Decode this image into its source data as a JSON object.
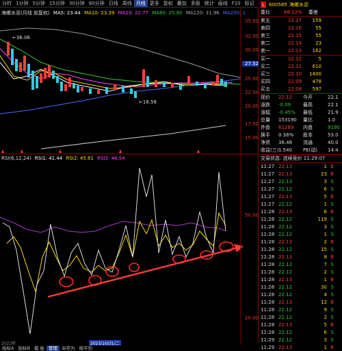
{
  "toolbar": {
    "items": [
      "分时",
      "1分钟",
      "5分钟",
      "15分钟",
      "30分钟",
      "60分钟",
      "日线",
      "周线",
      "月线",
      "更多",
      "复权",
      "叠加",
      "多股",
      "统计",
      "画线",
      "F10",
      "标记",
      "-",
      "-"
    ],
    "active_index": 8
  },
  "main_legend": {
    "name": "海螺水泥(月线 前复权)",
    "ma5": "MA5: 23.44",
    "ma10": "MA10: 23.39",
    "ma20": "MA20: 22.77",
    "ma60": "MA60: 25.80",
    "ma120": "MA120: 31.96",
    "ma250": "MA250: 1",
    "colors": {
      "ma5": "#ffffff",
      "ma10": "#ffdd00",
      "ma20": "#ff44ff",
      "ma60": "#33cc33",
      "ma120": "#999999",
      "ma250": "#4a6cff"
    }
  },
  "main_axis": [
    "35.00",
    "32.50",
    "30.00",
    "27.52",
    "25.00",
    "22.50",
    "20.00",
    "17.50",
    "15.00"
  ],
  "main_annotations": {
    "high": "36.06",
    "low": "18.58"
  },
  "rsi_legend": {
    "name": "RSI(6,12,24)",
    "rsi1": "RSI1: 41.44",
    "rsi2": "RSI2: 45.61",
    "rsi3": "RSI3: 46.54",
    "colors": {
      "rsi1": "#ffffff",
      "rsi2": "#ffdd00",
      "rsi3": "#ff44ff"
    }
  },
  "rsi_axis": [
    "50.00",
    "20.00"
  ],
  "date_bar": {
    "left": "2023年",
    "highlight": "2023/10/31/二"
  },
  "bottom_tabs": [
    "指标A",
    "指标B",
    "模 板",
    "管理",
    "另存为",
    "缩平到"
  ],
  "bottom_active": 3,
  "quote": {
    "code": "600585",
    "name": "海螺水泥",
    "ratio_label": "委比",
    "ratio_value": "68.12%",
    "diff_label": "委差",
    "diff_value": "",
    "asks": [
      {
        "label": "卖五",
        "price": "22.17",
        "vol": "159"
      },
      {
        "label": "卖四",
        "price": "22.16",
        "vol": "55"
      },
      {
        "label": "卖三",
        "price": "22.15",
        "vol": "55"
      },
      {
        "label": "卖二",
        "price": "22.14",
        "vol": "23"
      },
      {
        "label": "卖一",
        "price": "22.13",
        "vol": "162"
      }
    ],
    "bids": [
      {
        "label": "买一",
        "price": "22.12",
        "vol": "5"
      },
      {
        "label": "买二",
        "price": "22.11",
        "vol": "610"
      },
      {
        "label": "买三",
        "price": "22.10",
        "vol": "1400"
      },
      {
        "label": "买四",
        "price": "22.09",
        "vol": "478"
      },
      {
        "label": "买五",
        "price": "22.08",
        "vol": "597"
      }
    ],
    "stats": [
      {
        "l1": "现价",
        "v1": "22.12",
        "l2": "今开",
        "v2": "22.1"
      },
      {
        "l1": "涨跌",
        "v1": "-0.09",
        "l2": "最高",
        "v2": "22.1"
      },
      {
        "l1": "涨幅",
        "v1": "-0.45%",
        "l2": "最低",
        "v2": "21.9"
      },
      {
        "l1": "总量",
        "v1": "153190",
        "l2": "量比",
        "v2": "1.0"
      },
      {
        "l1": "外盘",
        "v1": "61289",
        "l2": "内盘",
        "v2": "9190"
      },
      {
        "l1": "换手",
        "v1": "0.38%",
        "l2": "股本",
        "v2": "53.0"
      },
      {
        "l1": "净资",
        "v1": "36.46",
        "l2": "流通",
        "v2": "40.0"
      },
      {
        "l1": "收益(三)",
        "v1": "1.540",
        "l2": "PE(动)",
        "v2": "14.4"
      }
    ],
    "status": "交易状态: 连续竞价 11:29:07",
    "ticks": [
      {
        "t": "11:27",
        "p": "22.13",
        "v": "1",
        "d": "B"
      },
      {
        "t": "11:27",
        "p": "22.13",
        "v": "23",
        "d": "B"
      },
      {
        "t": "11:27",
        "p": "22.13",
        "v": "3",
        "d": "S"
      },
      {
        "t": "11:27",
        "p": "22.12",
        "v": "6",
        "d": "S"
      },
      {
        "t": "11:27",
        "p": "22.13",
        "v": "5",
        "d": "B"
      },
      {
        "t": "11:27",
        "p": "22.12",
        "v": "1",
        "d": "S"
      },
      {
        "t": "11:28",
        "p": "22.13",
        "v": "6",
        "d": "B"
      },
      {
        "t": "11:28",
        "p": "22.12",
        "v": "119",
        "d": "S"
      },
      {
        "t": "11:28",
        "p": "22.12",
        "v": "3",
        "d": "S"
      },
      {
        "t": "11:28",
        "p": "22.12",
        "v": "1",
        "d": "S"
      },
      {
        "t": "11:28",
        "p": "22.13",
        "v": "2",
        "d": "B"
      },
      {
        "t": "11:28",
        "p": "22.12",
        "v": "15",
        "d": "S"
      },
      {
        "t": "11:28",
        "p": "22.13",
        "v": "8",
        "d": "B"
      },
      {
        "t": "11:28",
        "p": "22.12",
        "v": "7",
        "d": "S"
      },
      {
        "t": "11:28",
        "p": "22.12",
        "v": "2",
        "d": "S"
      },
      {
        "t": "11:28",
        "p": "22.13",
        "v": "1",
        "d": "B"
      },
      {
        "t": "11:28",
        "p": "22.12",
        "v": "30",
        "d": "S"
      },
      {
        "t": "11:28",
        "p": "22.12",
        "v": "4",
        "d": "S"
      },
      {
        "t": "11:28",
        "p": "22.13",
        "v": "12",
        "d": "B"
      },
      {
        "t": "11:28",
        "p": "22.12",
        "v": "9",
        "d": "S"
      },
      {
        "t": "11:28",
        "p": "22.12",
        "v": "2",
        "d": "S"
      },
      {
        "t": "11:28",
        "p": "22.13",
        "v": "5",
        "d": "B"
      },
      {
        "t": "11:28",
        "p": "22.12",
        "v": "6",
        "d": "S"
      },
      {
        "t": "11:29",
        "p": "22.12",
        "v": "3",
        "d": "S"
      },
      {
        "t": "11:29",
        "p": "22.13",
        "v": "1",
        "d": "B"
      },
      {
        "t": "11:29",
        "p": "22.12",
        "v": "2",
        "d": "S"
      },
      {
        "t": "11:29",
        "p": "22.12",
        "v": "8",
        "d": "S"
      },
      {
        "t": "11:29",
        "p": "22.13",
        "v": "4",
        "d": "B"
      },
      {
        "t": "11:29",
        "p": "22.12",
        "v": "1",
        "d": "S"
      },
      {
        "t": "11:29",
        "p": "22.12",
        "v": "5",
        "d": "S"
      },
      {
        "t": "11:29",
        "p": "22.12",
        "v": "2",
        "d": "S"
      },
      {
        "t": "11:29",
        "p": "22.12",
        "v": "6",
        "d": "S"
      },
      {
        "t": "11:29",
        "p": "22.12",
        "v": "3",
        "d": "S"
      }
    ],
    "side_tabs": [
      "笔",
      "价",
      "细",
      "势",
      "联",
      "值",
      "主",
      "筹"
    ]
  }
}
